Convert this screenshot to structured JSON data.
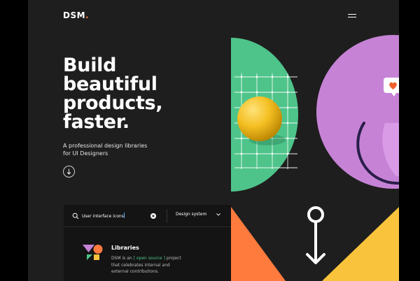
{
  "brand": {
    "name": "DSM",
    "dot": "."
  },
  "hero": {
    "title": "Build\nbeautiful\nproducts,\nfaster.",
    "subtitle": "A professional design libraries\nfor UI Designers"
  },
  "search": {
    "value": "User interface icons",
    "category_label": "Design system"
  },
  "library": {
    "title": "Libraries",
    "desc_prefix": "DSM is an",
    "desc_link": "[ open source ]",
    "desc_suffix": "project that celebrates internal and external contributions."
  },
  "icons": {
    "menu": "menu-icon",
    "scroll_down": "arrow-down-icon",
    "search": "search-icon",
    "clear": "close-icon",
    "dropdown": "chevron-down-icon",
    "libraries": "libraries-shapes-icon",
    "heart": "heart-icon"
  },
  "colors": {
    "background": "#1e1e1e",
    "accent_orange": "#ff7a3d",
    "green": "#4ec48a",
    "purple": "#c683d6",
    "yellow": "#f9c33c",
    "link_green": "#4ec48a"
  }
}
